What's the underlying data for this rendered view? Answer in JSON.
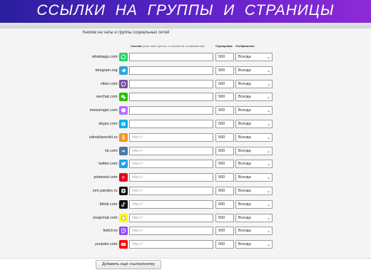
{
  "banner": {
    "title": "ССЫЛКИ  НА  ГРУППЫ  И  СТРАНИЦЫ"
  },
  "section": {
    "title": "Кнопки на чаты и группы социальных сетей"
  },
  "headers": {
    "link": "Ссылка",
    "link_note": "(если поле пустое, то кнопка не отображается)",
    "sort": "Сортировка",
    "display": "Отображение"
  },
  "rows": [
    {
      "domain": "whatsapp.com:",
      "icon": "whatsapp-icon",
      "color": "#25d366",
      "link": "",
      "placeholder": "",
      "sort": "500",
      "display": "Всегда"
    },
    {
      "domain": "telegram.org:",
      "icon": "telegram-icon",
      "color": "#2aa3df",
      "link": "",
      "placeholder": "",
      "sort": "500",
      "display": "Всегда"
    },
    {
      "domain": "viber.com:",
      "icon": "viber-icon",
      "color": "#7b519d",
      "link": "",
      "placeholder": "",
      "sort": "500",
      "display": "Всегда"
    },
    {
      "domain": "wechat.com:",
      "icon": "wechat-icon",
      "color": "#2dc100",
      "link": "",
      "placeholder": "",
      "sort": "500",
      "display": "Всегда"
    },
    {
      "domain": "messenger.com:",
      "icon": "messenger-icon",
      "color": "#b66dff",
      "link": "",
      "placeholder": "",
      "sort": "500",
      "display": "Всегда"
    },
    {
      "domain": "skype.com:",
      "icon": "skype-icon",
      "color": "#00aff0",
      "link": "",
      "placeholder": "",
      "sort": "500",
      "display": "Всегда"
    },
    {
      "domain": "odnoklassniki.ru:",
      "icon": "odnoklassniki-icon",
      "color": "#f7931e",
      "link": "",
      "placeholder": "https://",
      "sort": "500",
      "display": "Всегда"
    },
    {
      "domain": "vk.com:",
      "icon": "vk-icon",
      "color": "#4c75a3",
      "link": "",
      "placeholder": "https://",
      "sort": "500",
      "display": "Всегда"
    },
    {
      "domain": "twitter.com:",
      "icon": "twitter-icon",
      "color": "#1da1f2",
      "link": "",
      "placeholder": "https://",
      "sort": "500",
      "display": "Всегда"
    },
    {
      "domain": "pinterest.com:",
      "icon": "pinterest-icon",
      "color": "#e60023",
      "link": "",
      "placeholder": "https://",
      "sort": "500",
      "display": "Всегда"
    },
    {
      "domain": "zen.yandex.ru:",
      "icon": "yandex-zen-icon",
      "color": "#111111",
      "link": "",
      "placeholder": "https://",
      "sort": "500",
      "display": "Всегда"
    },
    {
      "domain": "tiktok.com:",
      "icon": "tiktok-icon",
      "color": "#111111",
      "link": "",
      "placeholder": "https://",
      "sort": "500",
      "display": "Всегда"
    },
    {
      "domain": "snapchat.com:",
      "icon": "snapchat-icon",
      "color": "#fffc00",
      "link": "",
      "placeholder": "https://",
      "sort": "500",
      "display": "Всегда"
    },
    {
      "domain": "twitch.tv:",
      "icon": "twitch-icon",
      "color": "#9146ff",
      "link": "",
      "placeholder": "https://",
      "sort": "500",
      "display": "Всегда"
    },
    {
      "domain": "youtube.com:",
      "icon": "youtube-icon",
      "color": "#ff0000",
      "link": "",
      "placeholder": "https://",
      "sort": "500",
      "display": "Всегда"
    }
  ],
  "add_button": {
    "label": "Добавить ещё ссылку/кнопку"
  }
}
